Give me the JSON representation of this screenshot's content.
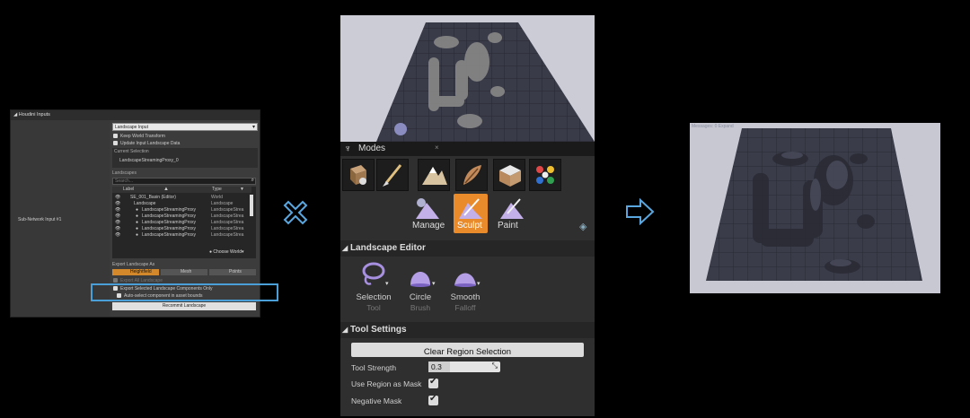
{
  "houdini_panel": {
    "title": "Houdini Inputs",
    "input_name": "Sub-Network Input #1",
    "input_type": "Landscape Input",
    "keep_world_transform": "Keep World Transform",
    "update_input_landscape": "Update Input Landscape Data",
    "current_selection_label": "Current Selection",
    "current_selection_value": "LandscapeStreamingProxy_0",
    "landscapes_label": "Landscapes",
    "search_placeholder": "Search...",
    "col_label": "Label",
    "col_type": "Type",
    "rows": [
      {
        "label": "SE_001_Basin (Editor)",
        "type": "World"
      },
      {
        "label": "Landscape",
        "type": "Landscape"
      },
      {
        "label": "LandscapeStreamingProxy",
        "type": "LandscapeStrea"
      },
      {
        "label": "LandscapeStreamingProxy",
        "type": "LandscapeStrea"
      },
      {
        "label": "LandscapeStreamingProxy",
        "type": "LandscapeStrea"
      },
      {
        "label": "LandscapeStreamingProxy",
        "type": "LandscapeStrea"
      },
      {
        "label": "LandscapeStreamingProxy",
        "type": "LandscapeStrea"
      }
    ],
    "choose_world": "Choose World",
    "export_as_label": "Export Landscape As",
    "export_options": [
      "Heightfield",
      "Mesh",
      "Points"
    ],
    "export_all": "Export All Landscape",
    "export_selected": "Export Selected Landscape Components Only",
    "auto_select": "Auto-select component in asset bounds",
    "recommit": "Recommit Landscape",
    "highlight_color": "#4a9fd8"
  },
  "modes_panel": {
    "tab_title": "Modes",
    "mode_icons": [
      "place-icon",
      "paint-brush-icon",
      "landscape-icon",
      "foliage-icon",
      "geometry-icon",
      "color-palette-icon"
    ],
    "landscape_modes": [
      "Manage",
      "Sculpt",
      "Paint"
    ],
    "active_mode": "Sculpt",
    "landscape_editor_title": "Landscape Editor",
    "tools": [
      {
        "name": "Selection",
        "sub": "Tool"
      },
      {
        "name": "Circle",
        "sub": "Brush"
      },
      {
        "name": "Smooth",
        "sub": "Falloff"
      }
    ],
    "tool_settings_title": "Tool Settings",
    "clear_region": "Clear Region Selection",
    "tool_strength_label": "Tool Strength",
    "tool_strength_value": "0.3",
    "use_region_mask": "Use Region as Mask",
    "negative_mask": "Negative Mask",
    "accent": "#e98b2a"
  },
  "result_viewport": {
    "caption": "Messages: 0 Expand"
  },
  "symbols": {
    "cross": "cross-icon",
    "arrow": "arrow-right-icon",
    "color": "#5aa7e0"
  }
}
